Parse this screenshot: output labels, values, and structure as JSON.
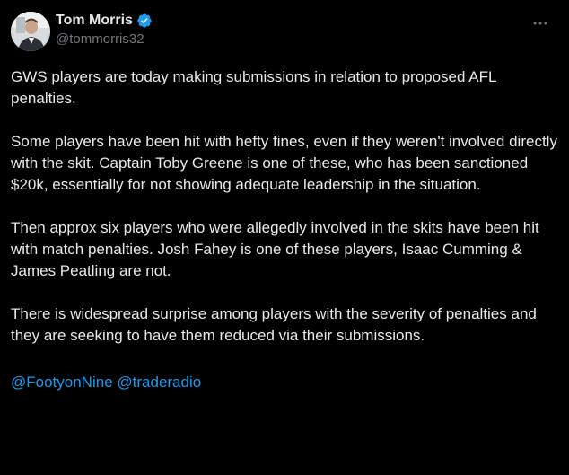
{
  "author": {
    "display_name": "Tom Morris",
    "handle": "@tommorris32",
    "verified_icon": "verified-badge-icon",
    "verified_color": "#1d9bf0"
  },
  "menu": {
    "icon": "more-horizontal-icon"
  },
  "tweet": {
    "paragraphs": [
      "GWS players are today making submissions in relation to proposed AFL penalties.",
      "Some players have been hit with hefty fines, even if they weren't involved directly with the skit. Captain Toby Greene is one of these, who has been sanctioned $20k, essentially for not showing adequate leadership in the situation.",
      "Then approx six players who were allegedly involved in the skits have been hit with match penalties. Josh Fahey is one of these players, Isaac Cumming & James Peatling are not.",
      "There is widespread surprise among players with the severity of penalties and they are seeking to have them reduced via their submissions."
    ],
    "mentions": [
      "@FootyonNine",
      "@traderadio"
    ]
  },
  "colors": {
    "background": "#000000",
    "text": "#e7e9ea",
    "secondary_text": "#71767b",
    "link": "#1d9bf0"
  }
}
